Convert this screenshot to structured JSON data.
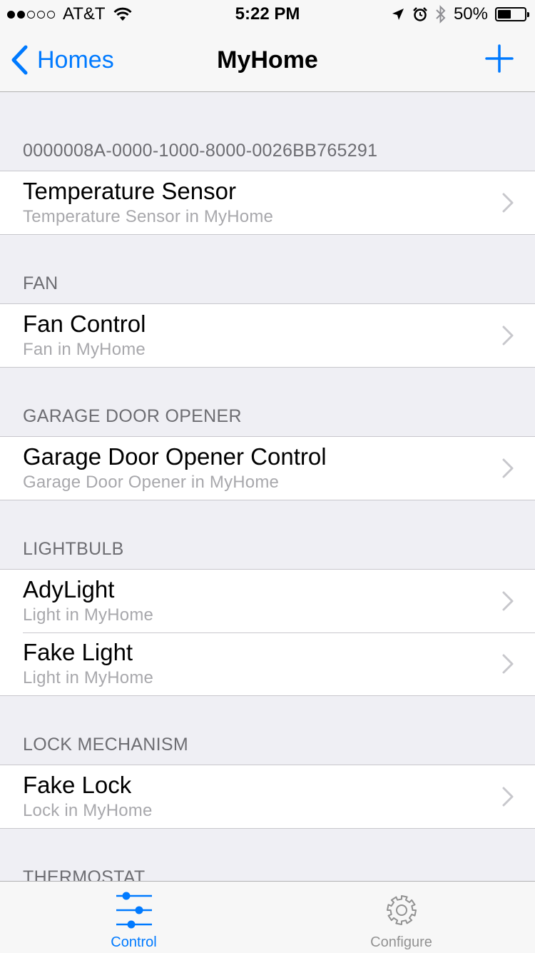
{
  "status_bar": {
    "signal_bars_filled": 2,
    "signal_bars_total": 5,
    "carrier": "AT&T",
    "time": "5:22 PM",
    "battery_percent": "50%",
    "battery_level": 0.5
  },
  "nav": {
    "back_label": "Homes",
    "title": "MyHome"
  },
  "sections": [
    {
      "header": "0000008A-0000-1000-8000-0026BB765291",
      "rows": [
        {
          "title": "Temperature Sensor",
          "subtitle": "Temperature Sensor in MyHome"
        }
      ]
    },
    {
      "header": "FAN",
      "rows": [
        {
          "title": "Fan Control",
          "subtitle": "Fan in MyHome"
        }
      ]
    },
    {
      "header": "GARAGE DOOR OPENER",
      "rows": [
        {
          "title": "Garage Door Opener Control",
          "subtitle": "Garage Door Opener in MyHome"
        }
      ]
    },
    {
      "header": "LIGHTBULB",
      "rows": [
        {
          "title": "AdyLight",
          "subtitle": "Light in MyHome"
        },
        {
          "title": "Fake Light",
          "subtitle": "Light in MyHome"
        }
      ]
    },
    {
      "header": "LOCK MECHANISM",
      "rows": [
        {
          "title": "Fake Lock",
          "subtitle": "Lock in MyHome"
        }
      ]
    },
    {
      "header": "THERMOSTAT",
      "rows": []
    }
  ],
  "tabs": [
    {
      "label": "Control",
      "icon": "sliders-icon",
      "active": true
    },
    {
      "label": "Configure",
      "icon": "gear-icon",
      "active": false
    }
  ],
  "colors": {
    "accent": "#007aff",
    "background": "#efeff4",
    "section_header_text": "#6d6d72",
    "subtitle_text": "#a8a8ac",
    "chevron": "#c7c7cc",
    "inactive_tab": "#929292"
  }
}
